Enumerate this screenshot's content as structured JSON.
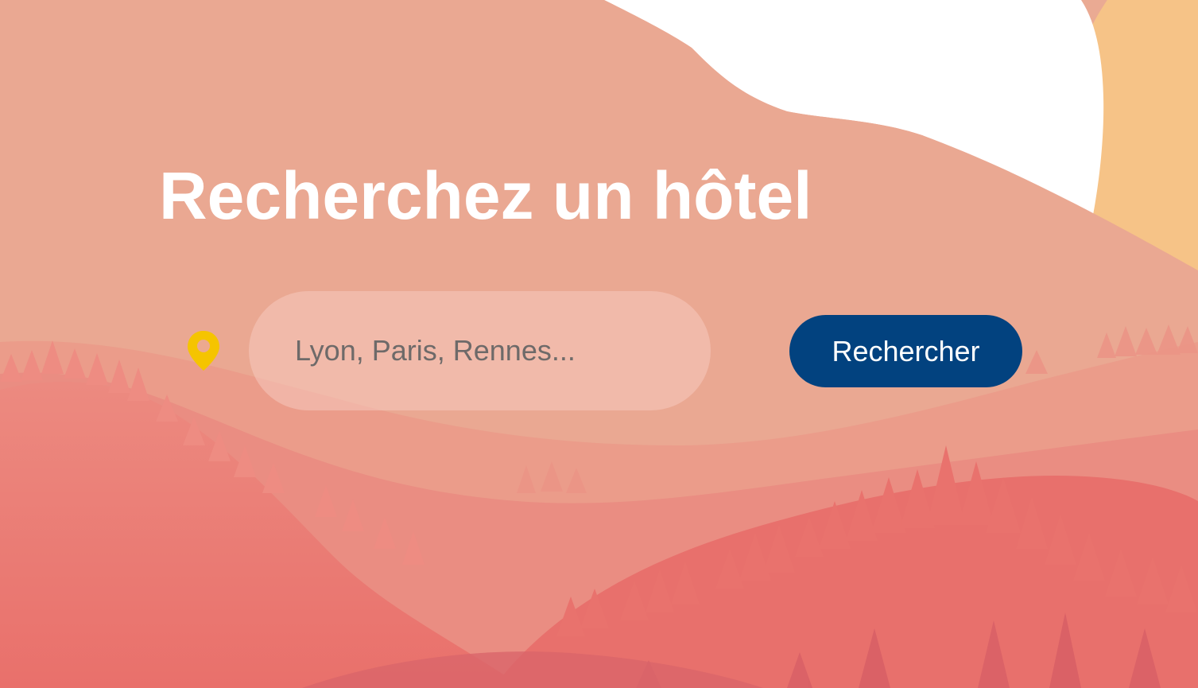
{
  "hero": {
    "title": "Recherchez un hôtel"
  },
  "search": {
    "location_icon": "map-pin-icon",
    "placeholder": "Lyon, Paris, Rennes...",
    "value": "",
    "button_label": "Rechercher"
  },
  "colors": {
    "button_background": "#02427f",
    "pin_icon": "#f5c400",
    "title_text": "#ffffff",
    "background_top": "#eaa892",
    "background_bottom": "#e96f69",
    "sun": "#f6c387"
  }
}
